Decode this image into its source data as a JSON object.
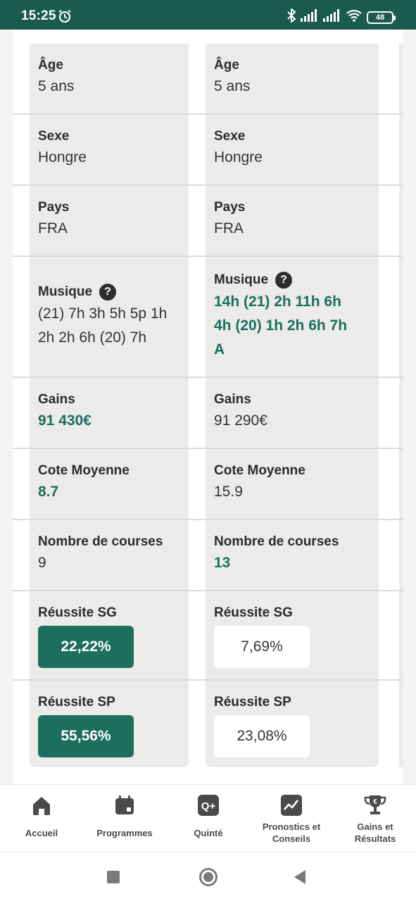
{
  "status": {
    "time": "15:25",
    "battery": "48"
  },
  "columns": {
    "left": {
      "age": {
        "label": "Âge",
        "value": "5 ans"
      },
      "sexe": {
        "label": "Sexe",
        "value": "Hongre"
      },
      "pays": {
        "label": "Pays",
        "value": "FRA"
      },
      "musique": {
        "label": "Musique",
        "help": "?",
        "lines": [
          "(21) 7h 3h 5h 5p 1h",
          "2h 2h 6h (20) 7h"
        ]
      },
      "gains": {
        "label": "Gains",
        "value": "91 430€"
      },
      "cote": {
        "label": "Cote Moyenne",
        "value": "8.7"
      },
      "courses": {
        "label": "Nombre de courses",
        "value": "9"
      },
      "sg": {
        "label": "Réussite SG",
        "value": "22,22%"
      },
      "sp": {
        "label": "Réussite SP",
        "value": "55,56%"
      }
    },
    "right": {
      "age": {
        "label": "Âge",
        "value": "5 ans"
      },
      "sexe": {
        "label": "Sexe",
        "value": "Hongre"
      },
      "pays": {
        "label": "Pays",
        "value": "FRA"
      },
      "musique": {
        "label": "Musique",
        "help": "?",
        "lines": [
          "14h (21) 2h 11h 6h",
          "4h (20) 1h 2h 6h 7h",
          "A"
        ]
      },
      "gains": {
        "label": "Gains",
        "value": "91 290€"
      },
      "cote": {
        "label": "Cote Moyenne",
        "value": "15.9"
      },
      "courses": {
        "label": "Nombre de courses",
        "value": "13"
      },
      "sg": {
        "label": "Réussite SG",
        "value": "7,69%"
      },
      "sp": {
        "label": "Réussite SP",
        "value": "23,08%"
      }
    }
  },
  "tabs": [
    {
      "label": "Accueil",
      "icon": "home-icon"
    },
    {
      "label": "Programmes",
      "icon": "calendar-icon"
    },
    {
      "label": "Quinté",
      "icon": "quinte-icon"
    },
    {
      "label": "Pronostics et Conseils",
      "icon": "chart-icon"
    },
    {
      "label": "Gains et Résultats",
      "icon": "trophy-icon"
    }
  ],
  "colors": {
    "brand": "#1a5b4d",
    "accent": "#1c6e5d",
    "panel": "#ebebea"
  }
}
